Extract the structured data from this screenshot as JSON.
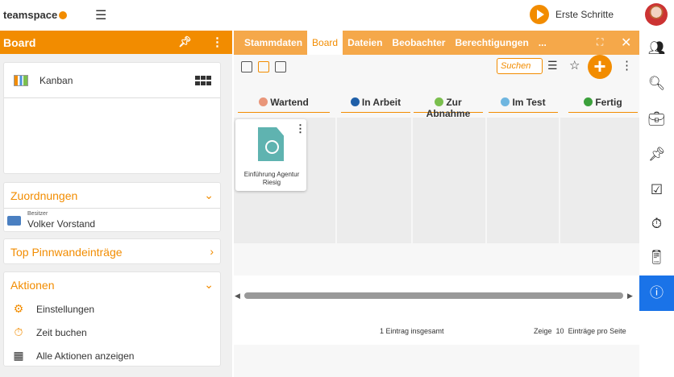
{
  "app": {
    "logo": "teamspace",
    "menu_icon": "hamburger-icon",
    "help_label": "Erste Schritte"
  },
  "left_panel": {
    "title": "Board",
    "kanban_label": "Kanban",
    "zuordnungen": {
      "title": "Zuordnungen",
      "owner_sublabel": "Besitzer",
      "owner_name": "Volker Vorstand"
    },
    "pinnwand": {
      "title": "Top Pinnwandeinträge"
    },
    "aktionen": {
      "title": "Aktionen",
      "items": [
        {
          "label": "Einstellungen",
          "icon": "gears-icon"
        },
        {
          "label": "Zeit buchen",
          "icon": "stopwatch-icon"
        },
        {
          "label": "Alle Aktionen anzeigen",
          "icon": "grid-icon"
        }
      ]
    }
  },
  "main": {
    "tabs": [
      {
        "label": "Stammdaten"
      },
      {
        "label": "Board"
      },
      {
        "label": "Dateien"
      },
      {
        "label": "Beobachter"
      },
      {
        "label": "Berechtigungen"
      },
      {
        "label": "..."
      }
    ],
    "active_tab": "Board",
    "search_placeholder": "Suchen",
    "columns": [
      {
        "label": "Wartend",
        "color": "#e9967a"
      },
      {
        "label": "In Arbeit",
        "color": "#1f5fa8"
      },
      {
        "label": "Zur Abnahme",
        "color": "#7bbf4e"
      },
      {
        "label": "Im Test",
        "color": "#6fb6e0"
      },
      {
        "label": "Fertig",
        "color": "#3ba03b"
      }
    ],
    "task": {
      "title": "Einführung Agentur Riesig"
    },
    "footer": {
      "count": "1 Eintrag insgesamt",
      "show": "Zeige",
      "per_page_value": "10",
      "per_page_label": "Einträge pro Seite"
    }
  },
  "colors": {
    "accent": "#f28c00",
    "active_rail": "#1a73e8"
  }
}
